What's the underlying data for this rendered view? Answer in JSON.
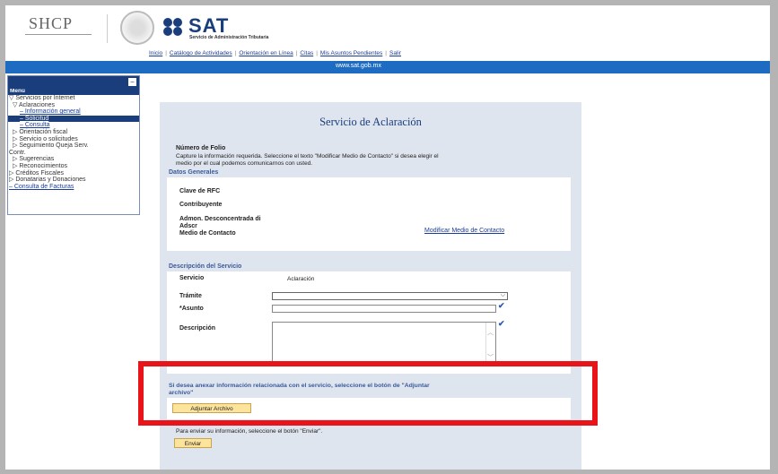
{
  "header": {
    "shcp_logo_text": "SHCP",
    "sat_logo_text": "SAT",
    "sat_subtitle": "Servicio de Administración Tributaria"
  },
  "top_nav": {
    "items": [
      "Inicio",
      "Catálogo de Actividades",
      "Orientación en Línea",
      "Citas",
      "Mis Asuntos Pendientes",
      "Salir"
    ]
  },
  "bluebar": {
    "url": "www.sat.gob.mx"
  },
  "menu": {
    "title": "Menú",
    "collapse_symbol": "−",
    "items": [
      "▽ Servicios por Internet",
      "▽ Aclaraciones",
      "– Información general",
      "– Solicitud",
      "– Consulta",
      "▷ Orientación fiscal",
      "▷ Servicio o solicitudes",
      "▷ Seguimiento Queja Serv.",
      "Contr.",
      "▷ Sugerencias",
      "▷ Reconocimientos",
      "▷ Créditos Fiscales",
      "▷ Donatarias y Donaciones",
      "– Consulta de Facturas"
    ]
  },
  "form": {
    "title": "Servicio de Aclaración",
    "folio_label": "Número de Folio",
    "instructions_line1": "Capture la información requerida. Seleccione el texto \"Modificar Medio de Contacto\" si desea elegir el",
    "instructions_line2": "medio por el cual podemos comunicarnos con usted.",
    "datos_generales_title": "Datos Generales",
    "rfc_label": "Clave de RFC",
    "contribuyente_label": "Contribuyente",
    "admon_label_line1": "Admon. Desconcentrada di",
    "admon_label_line2": "Adscr",
    "medio_label": "Medio de Contacto",
    "modificar_link": "Modificar Medio de Contacto",
    "descripcion_servicio_title": "Descripción del Servicio",
    "servicio_label": "Servicio",
    "servicio_value": "Aclaración",
    "tramite_label": "Trámite",
    "tramite_value": "",
    "asunto_label": "*Asunto",
    "asunto_value": "",
    "descripcion_label": "Descripción",
    "descripcion_value": "",
    "adjuntar_text_line1": "Si desea anexar información relacionada con el servicio, seleccione el botón de \"Adjuntar",
    "adjuntar_text_line2": "archivo\"",
    "adjuntar_button": "Adjuntar Archivo",
    "enviar_text": "Para enviar su información, seleccione el botón \"Enviar\".",
    "enviar_button": "Enviar"
  },
  "colors": {
    "brand_blue": "#1a3d7c",
    "bar_blue": "#1e6cc2",
    "form_bg": "#dfe5ee",
    "button_yellow": "#fde49c",
    "highlight_red": "#e8141a"
  }
}
